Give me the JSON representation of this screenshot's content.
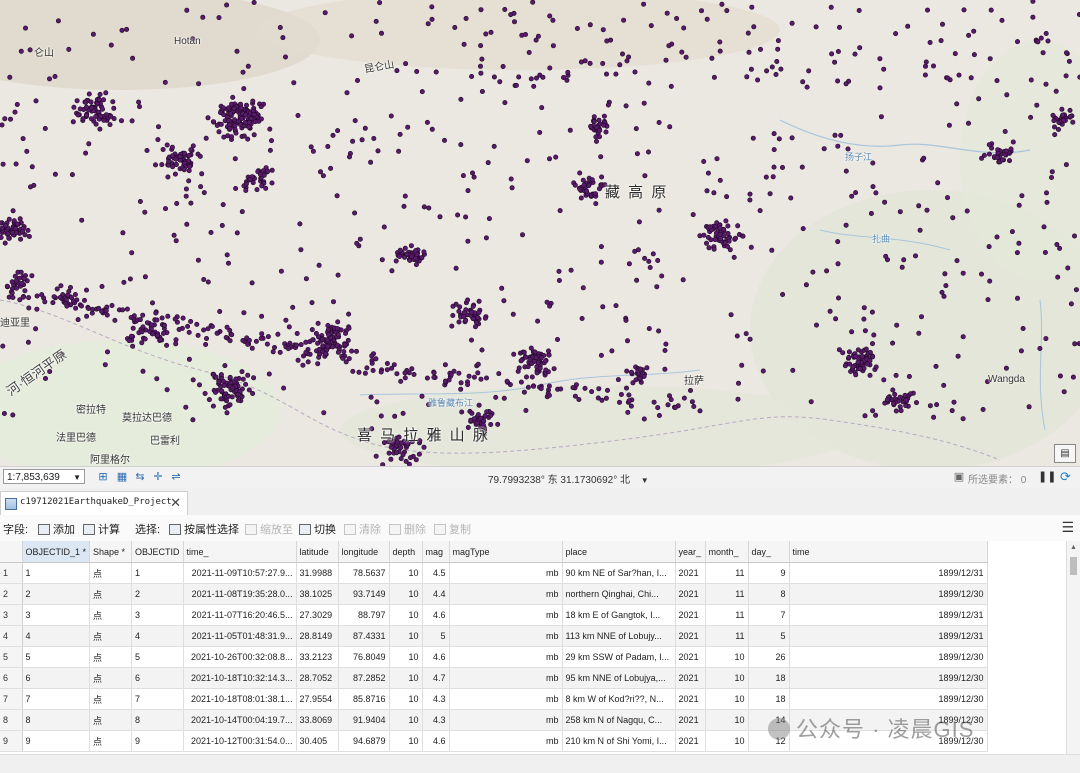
{
  "map": {
    "labels": {
      "hotan": "Hotan",
      "kunlun": "昆仑山",
      "kunlun2": "仑山",
      "tibet_plateau": "藏 高 原",
      "himalaya": "喜 马 拉 雅 山 脉",
      "lhasa": "拉萨",
      "wangda": "Wangda",
      "mirat": "密拉特",
      "morada": "莫拉达巴德",
      "bareilly": "巴雷利",
      "faribad": "法里巴德",
      "aligarh": "阿里格尔",
      "dehra": "迪亚里",
      "gangetic": "河·恒河平原",
      "yarlung": "雅鲁藏布江",
      "yangtze": "扬子江",
      "zhaqu": "扎曲"
    },
    "point_color": "#5a1a6b",
    "point_stroke": "#1e0826",
    "basemap_icon": "basemap-icon"
  },
  "statusbar": {
    "scale": "1:7,853,639",
    "coordinates": "79.7993238° 东  31.1730692° 北",
    "selected_label": "所选要素：",
    "selected_count": "0"
  },
  "table_tab": {
    "title": "c19712021EarthquakeD_Project"
  },
  "toolbar": {
    "field_label": "字段:",
    "add": "添加",
    "calculate": "计算",
    "select_label": "选择:",
    "select_by_attr": "按属性选择",
    "zoom_to": "缩放至",
    "switch": "切换",
    "clear": "清除",
    "delete": "删除",
    "copy": "复制"
  },
  "table": {
    "columns": [
      "OBJECTID_1 *",
      "Shape *",
      "OBJECTID",
      "time_",
      "latitude",
      "longitude",
      "depth",
      "mag",
      "magType",
      "place",
      "year_",
      "month_",
      "day_",
      "time"
    ],
    "rows": [
      [
        "1",
        "1",
        "点",
        "1",
        "2021-11-09T10:57:27.9...",
        "31.9988",
        "78.5637",
        "10",
        "4.5",
        "mb",
        "90 km NE of Sar?han, I...",
        "2021",
        "11",
        "9",
        "1899/12/31"
      ],
      [
        "2",
        "2",
        "点",
        "2",
        "2021-11-08T19:35:28.0...",
        "38.1025",
        "93.7149",
        "10",
        "4.4",
        "mb",
        "northern Qinghai, Chi...",
        "2021",
        "11",
        "8",
        "1899/12/30"
      ],
      [
        "3",
        "3",
        "点",
        "3",
        "2021-11-07T16:20:46.5...",
        "27.3029",
        "88.797",
        "10",
        "4.6",
        "mb",
        "18 km E of Gangtok, I...",
        "2021",
        "11",
        "7",
        "1899/12/31"
      ],
      [
        "4",
        "4",
        "点",
        "4",
        "2021-11-05T01:48:31.9...",
        "28.8149",
        "87.4331",
        "10",
        "5",
        "mb",
        "113 km NNE of Lobujy...",
        "2021",
        "11",
        "5",
        "1899/12/31"
      ],
      [
        "5",
        "5",
        "点",
        "5",
        "2021-10-26T00:32:08.8...",
        "33.2123",
        "76.8049",
        "10",
        "4.6",
        "mb",
        "29 km SSW of Padam, I...",
        "2021",
        "10",
        "26",
        "1899/12/30"
      ],
      [
        "6",
        "6",
        "点",
        "6",
        "2021-10-18T10:32:14.3...",
        "28.7052",
        "87.2852",
        "10",
        "4.7",
        "mb",
        "95 km NNE of Lobujya,...",
        "2021",
        "10",
        "18",
        "1899/12/30"
      ],
      [
        "7",
        "7",
        "点",
        "7",
        "2021-10-18T08:01:38.1...",
        "27.9554",
        "85.8716",
        "10",
        "4.3",
        "mb",
        "8 km W of Kod?ri??, N...",
        "2021",
        "10",
        "18",
        "1899/12/30"
      ],
      [
        "8",
        "8",
        "点",
        "8",
        "2021-10-14T00:04:19.7...",
        "33.8069",
        "91.9404",
        "10",
        "4.3",
        "mb",
        "258 km N of Nagqu, C...",
        "2021",
        "10",
        "14",
        "1899/12/30"
      ],
      [
        "9",
        "9",
        "点",
        "9",
        "2021-10-12T00:31:54.0...",
        "30.405",
        "94.6879",
        "10",
        "4.6",
        "mb",
        "210 km N of Shi Yomi, I...",
        "2021",
        "10",
        "12",
        "1899/12/30"
      ]
    ]
  },
  "watermark": "公众号 · 凌晨GIS"
}
